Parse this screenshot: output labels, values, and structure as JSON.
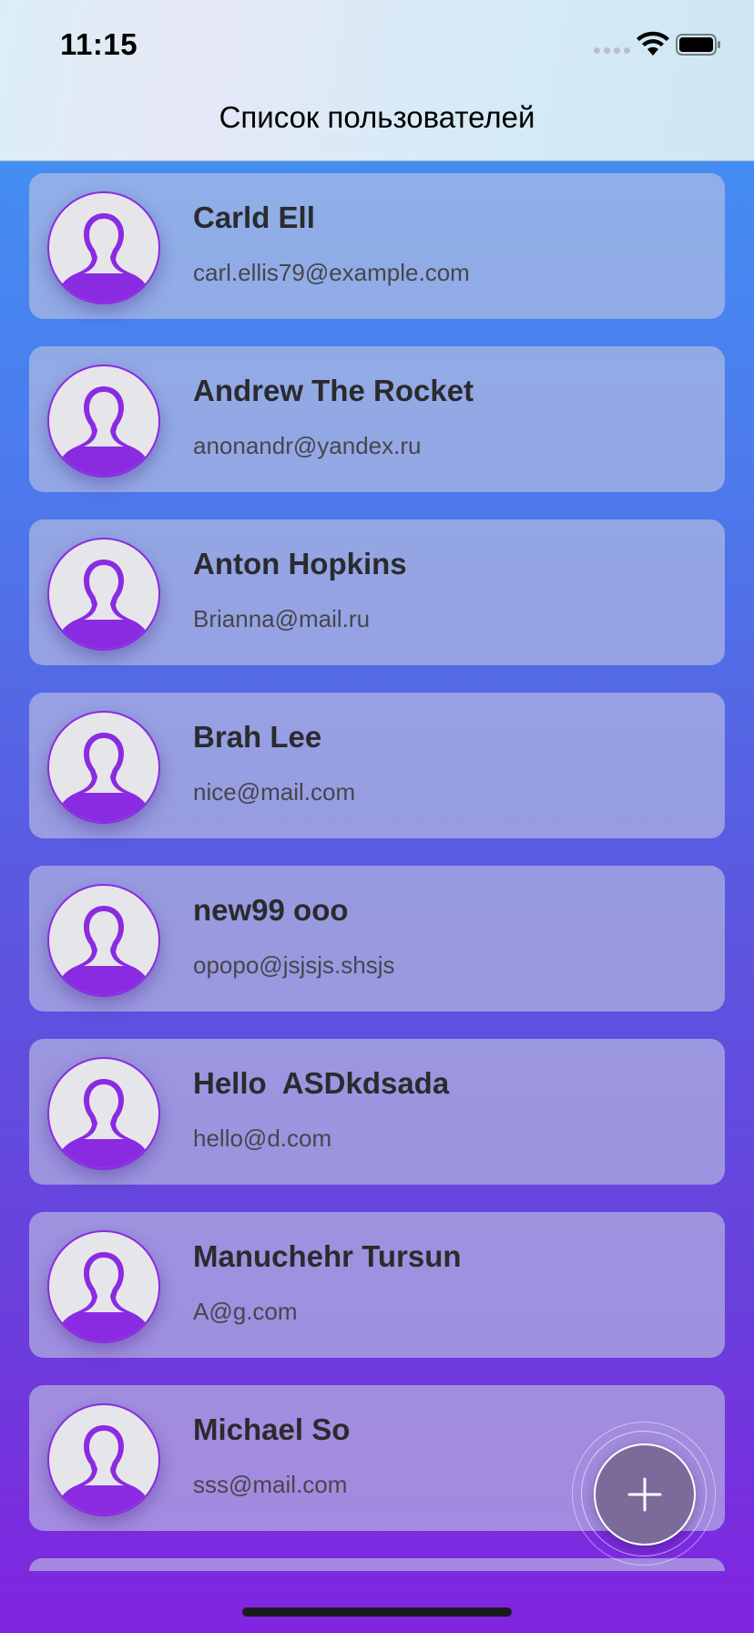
{
  "status_bar": {
    "time": "11:15",
    "icons": [
      "cellular-signal-icon",
      "wifi-icon",
      "battery-icon"
    ]
  },
  "header": {
    "title": "Список пользователей"
  },
  "users": [
    {
      "name": "Carld Ell",
      "email": "carl.ellis79@example.com"
    },
    {
      "name": "Andrew The Rocket",
      "email": "anonandr@yandex.ru"
    },
    {
      "name": "Anton Hopkins",
      "email": "Brianna@mail.ru"
    },
    {
      "name": "Brah Lee",
      "email": "nice@mail.com"
    },
    {
      "name": "new99 ooo",
      "email": "opopo@jsjsjs.shsjs"
    },
    {
      "name": "Hello  ASDkdsada",
      "email": "hello@d.com"
    },
    {
      "name": "Manuchehr Tursun",
      "email": "A@g.com"
    },
    {
      "name": "Michael So",
      "email": "sss@mail.com"
    }
  ],
  "fab": {
    "icon": "plus-icon"
  },
  "colors": {
    "accent": "#8a2be2",
    "gradient_top": "#3f97f5",
    "gradient_bottom": "#8124e0",
    "fab_fill": "#7b6a9a"
  }
}
